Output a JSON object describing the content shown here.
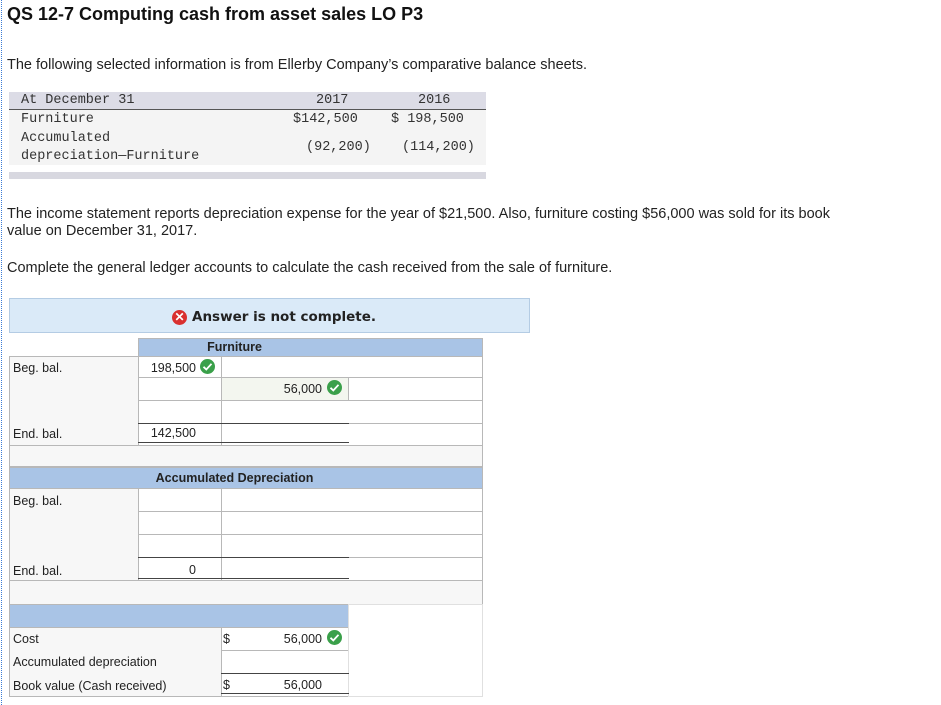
{
  "title": "QS 12-7 Computing cash from asset sales LO P3",
  "intro": "The following selected information is from Ellerby Company’s comparative balance sheets.",
  "balance_sheet": {
    "header": {
      "label": "At December 31",
      "col1": "2017",
      "col2": "2016"
    },
    "rows": [
      {
        "label": "Furniture",
        "v2017": "$142,500",
        "v2016": "$ 198,500"
      },
      {
        "label_line1": "Accumulated",
        "label_line2": "depreciation—Furniture",
        "v2017": "(92,200)",
        "v2016": "(114,200)"
      }
    ]
  },
  "paragraph1_line1": "The income statement reports depreciation expense for the year of $21,500. Also, furniture costing $56,000 was sold for its book",
  "paragraph1_line2": "value on December 31, 2017.",
  "paragraph2": "Complete the general ledger accounts to calculate the cash received from the sale of furniture.",
  "banner": "Answer is not complete.",
  "furniture": {
    "title": "Furniture",
    "beg_label": "Beg. bal.",
    "beg_value": "198,500",
    "credit_value": "56,000",
    "end_label": "End. bal.",
    "end_value": "142,500"
  },
  "accum": {
    "title": "Accumulated Depreciation",
    "beg_label": "Beg. bal.",
    "end_label": "End. bal.",
    "end_value": "0"
  },
  "summary": {
    "cost_label": "Cost",
    "cost_currency": "$",
    "cost_value": "56,000",
    "accum_label": "Accumulated depreciation",
    "book_label": "Book value (Cash received)",
    "book_currency": "$",
    "book_value": "56,000"
  }
}
